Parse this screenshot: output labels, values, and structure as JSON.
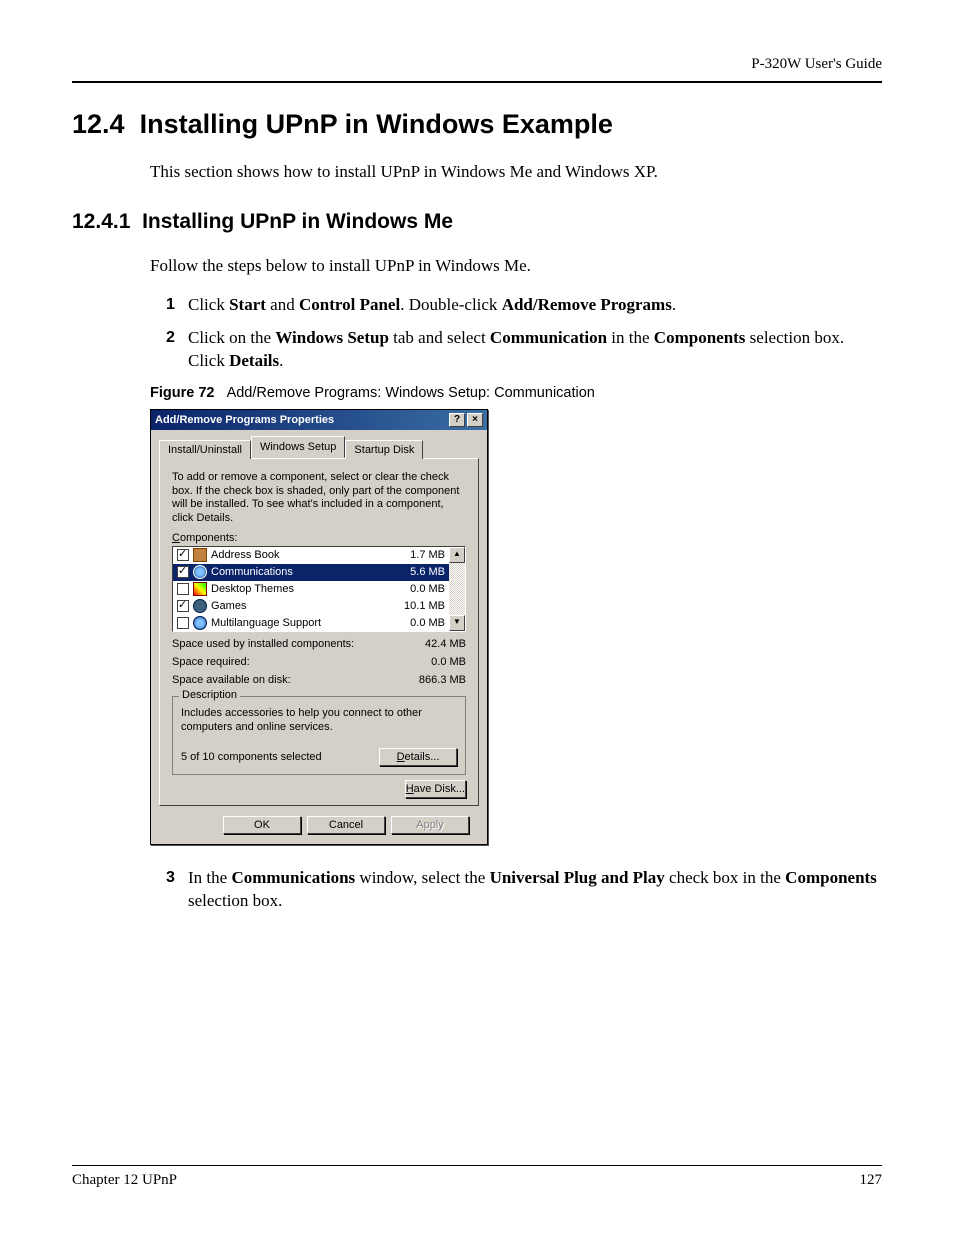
{
  "header": {
    "right": "P-320W User's Guide"
  },
  "section": {
    "number": "12.4",
    "title": "Installing UPnP in Windows Example",
    "intro": "This section shows how to install UPnP in Windows Me and Windows XP."
  },
  "subsection": {
    "number": "12.4.1",
    "title": "Installing UPnP in Windows Me",
    "intro": "Follow the steps below to install UPnP in Windows Me."
  },
  "steps": {
    "s1": {
      "num": "1",
      "pre": "Click ",
      "b1": "Start",
      "mid1": " and ",
      "b2": "Control Panel",
      "mid2": ". Double-click ",
      "b3": "Add/Remove Programs",
      "post": "."
    },
    "s2": {
      "num": "2",
      "pre": "Click on the ",
      "b1": "Windows Setup",
      "mid1": " tab and select ",
      "b2": "Communication",
      "mid2": " in the ",
      "b3": "Components",
      "mid3": " selection box. Click ",
      "b4": "Details",
      "post": "."
    },
    "s3": {
      "num": "3",
      "pre": "In the ",
      "b1": "Communications",
      "mid1": " window, select the ",
      "b2": "Universal Plug and Play",
      "mid2": " check box in the ",
      "b3": "Components",
      "post": " selection box."
    }
  },
  "figure": {
    "label": "Figure 72",
    "caption": "Add/Remove Programs: Windows Setup: Communication"
  },
  "dialog": {
    "title": "Add/Remove Programs Properties",
    "help": "?",
    "close": "×",
    "tabs": {
      "t1": "Install/Uninstall",
      "t2": "Windows Setup",
      "t3": "Startup Disk"
    },
    "instructions": "To add or remove a component, select or clear the check box. If the check box is shaded, only part of the component will be installed. To see what's included in a component, click Details.",
    "components_label_pre": "C",
    "components_label": "omponents:",
    "items": [
      {
        "name": "Address Book",
        "size": "1.7 MB",
        "checked": true,
        "icon": "book"
      },
      {
        "name": "Communications",
        "size": "5.6 MB",
        "checked": true,
        "icon": "globe",
        "selected": true
      },
      {
        "name": "Desktop Themes",
        "size": "0.0 MB",
        "checked": false,
        "icon": "theme"
      },
      {
        "name": "Games",
        "size": "10.1 MB",
        "checked": true,
        "icon": "game"
      },
      {
        "name": "Multilanguage Support",
        "size": "0.0 MB",
        "checked": false,
        "icon": "lang"
      }
    ],
    "space": {
      "used_k": "Space used by installed components:",
      "used_v": "42.4 MB",
      "req_k": "Space required:",
      "req_v": "0.0 MB",
      "avail_k": "Space available on disk:",
      "avail_v": "866.3 MB"
    },
    "description": {
      "legend": "Description",
      "text": "Includes accessories to help you connect to other computers and online services.",
      "selected": "5 of 10 components selected",
      "details_pre": "D",
      "details": "etails..."
    },
    "havedisk_pre": "H",
    "havedisk": "ave Disk...",
    "buttons": {
      "ok": "OK",
      "cancel": "Cancel",
      "apply": "Apply"
    }
  },
  "footer": {
    "left": "Chapter 12 UPnP",
    "right": "127"
  }
}
